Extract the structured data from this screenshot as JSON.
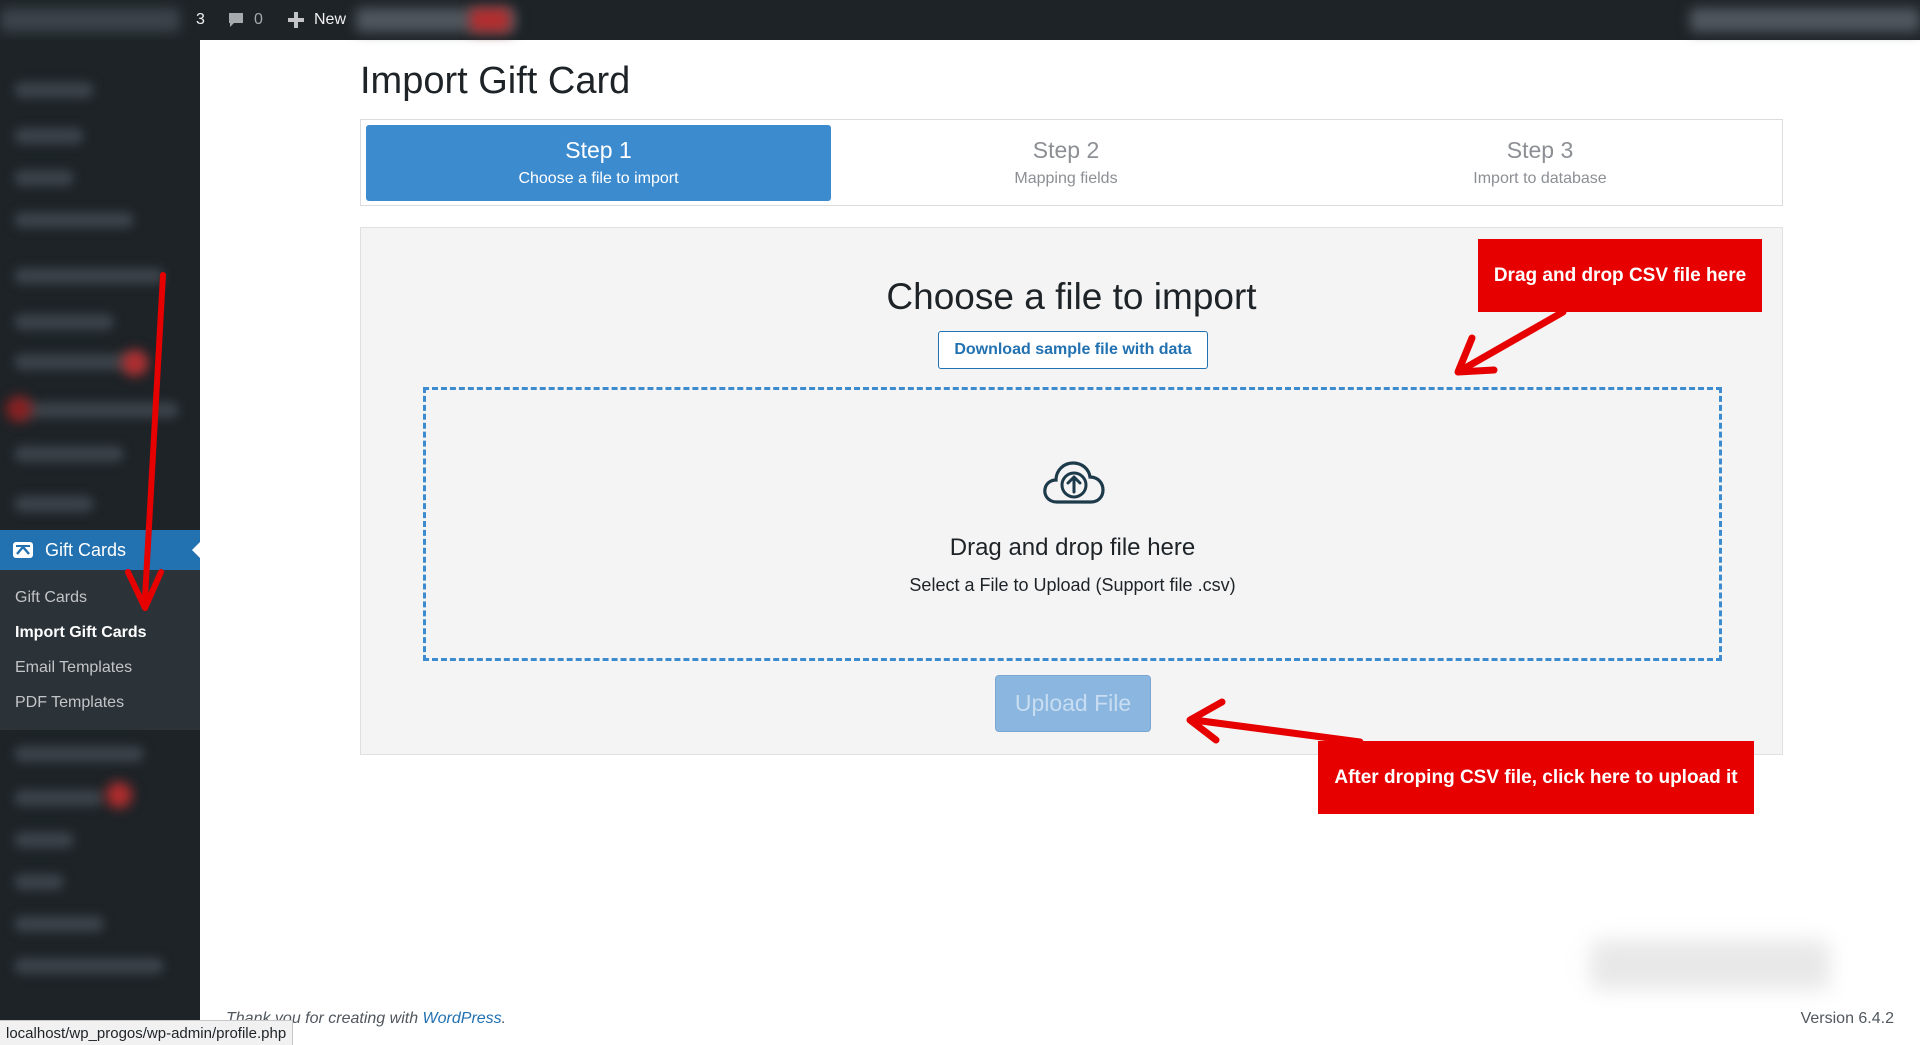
{
  "adminbar": {
    "update_count": "3",
    "comment_count": "0",
    "new_label": "New"
  },
  "sidebar": {
    "gift_cards_menu_label": "Gift Cards",
    "submenu": [
      {
        "label": "Gift Cards"
      },
      {
        "label": "Import Gift Cards"
      },
      {
        "label": "Email Templates"
      },
      {
        "label": "PDF Templates"
      }
    ]
  },
  "main": {
    "title": "Import Gift Card",
    "steps": [
      {
        "title": "Step 1",
        "subtitle": "Choose a file to import",
        "state": "active"
      },
      {
        "title": "Step 2",
        "subtitle": "Mapping fields",
        "state": "inactive"
      },
      {
        "title": "Step 3",
        "subtitle": "Import to database",
        "state": "inactive"
      }
    ],
    "choose_title": "Choose a file to import",
    "sample_button": "Download sample file with data",
    "dropzone_title": "Drag and drop file here",
    "dropzone_subtitle": "Select a File to Upload (Support file .csv)",
    "upload_button": "Upload File"
  },
  "annotations": {
    "drag_callout": "Drag and drop CSV file here",
    "upload_callout": "After droping CSV file, click here to upload it"
  },
  "footer": {
    "thanks_prefix": "Thank you for creating with ",
    "thanks_link": "WordPress",
    "thanks_suffix": ".",
    "version": "Version 6.4.2",
    "status_url": "localhost/wp_progos/wp-admin/profile.php"
  },
  "colors": {
    "accent": "#2271b1",
    "step_active": "#3d8bcf",
    "callout": "#e60000",
    "sidebar_bg": "#1d2327"
  },
  "icons": {
    "comment": "comment-icon",
    "new": "plus-icon",
    "gift_cards": "gift-card-icon",
    "upload": "cloud-upload-icon"
  }
}
